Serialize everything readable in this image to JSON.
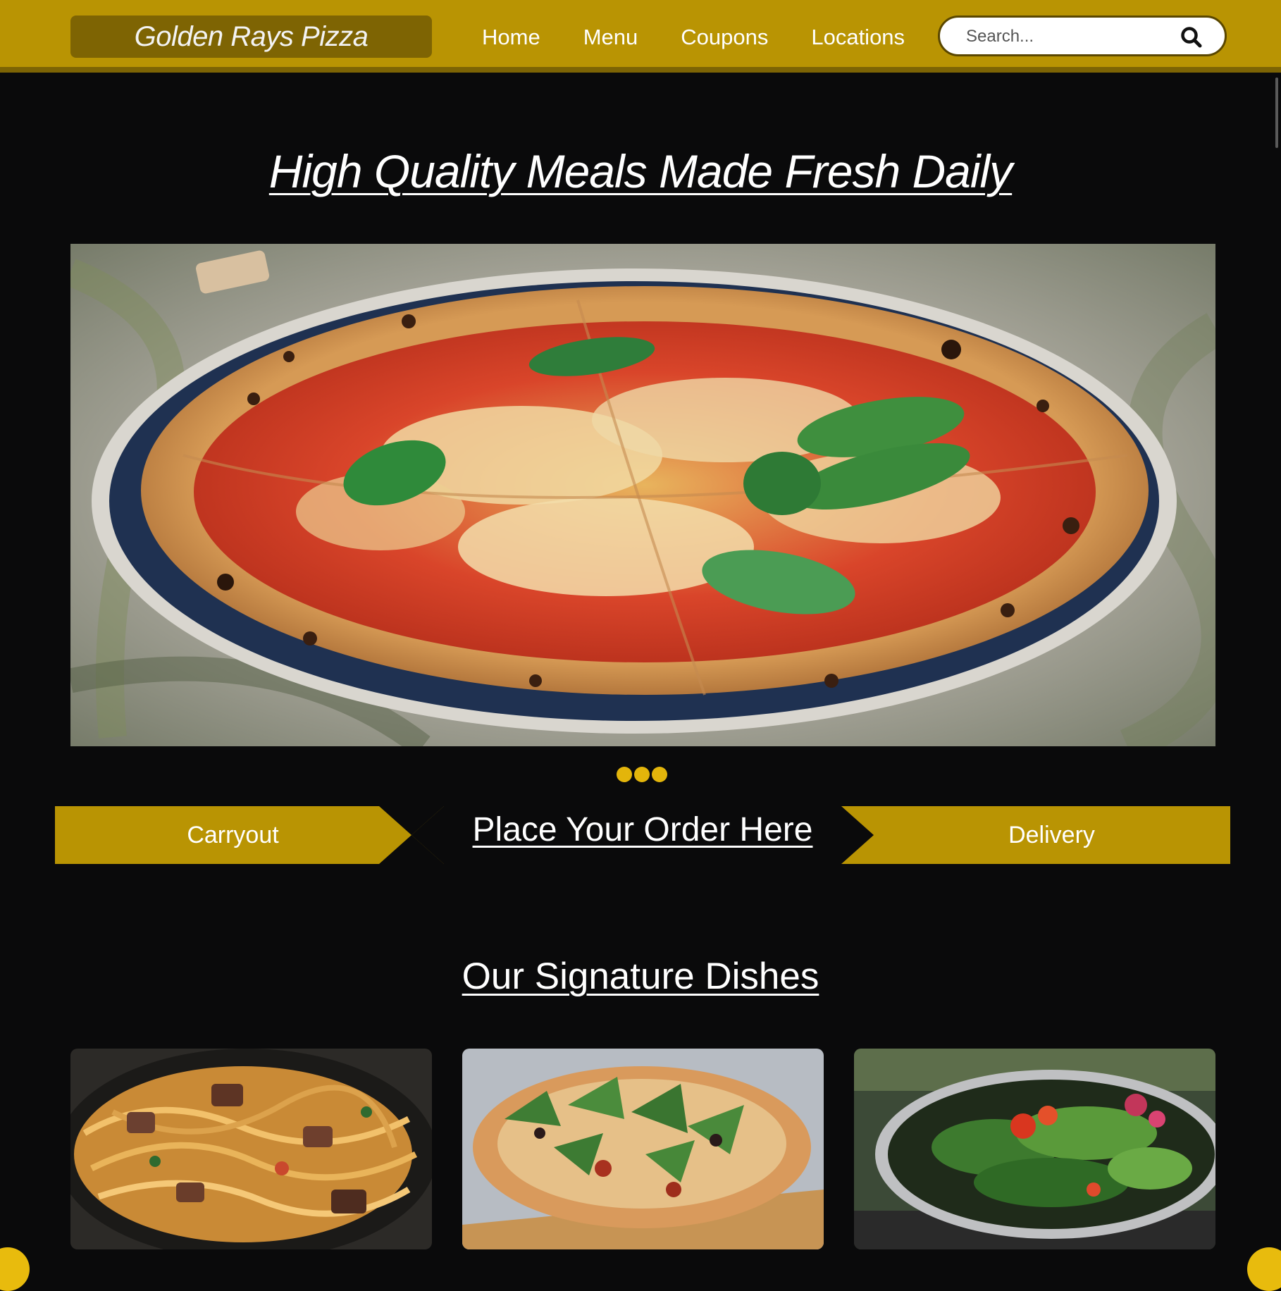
{
  "header": {
    "logo_text": "Golden Rays Pizza",
    "nav": [
      {
        "label": "Home"
      },
      {
        "label": "Menu"
      },
      {
        "label": "Coupons"
      },
      {
        "label": "Locations"
      }
    ],
    "search": {
      "placeholder": "Search...",
      "icon": "search-icon"
    }
  },
  "hero": {
    "title": "High Quality Meals Made Fresh Daily",
    "image": "margherita-pizza-photo",
    "carousel_dots": 3
  },
  "order": {
    "carryout_label": "Carryout",
    "heading": "Place Your Order Here",
    "delivery_label": "Delivery"
  },
  "signature": {
    "heading": "Our Signature Dishes",
    "dishes": [
      {
        "image": "pasta-with-beef-photo"
      },
      {
        "image": "arugula-pizza-photo"
      },
      {
        "image": "green-salad-photo"
      }
    ]
  },
  "colors": {
    "header_bg": "#b99403",
    "logo_bg": "#7e6403",
    "accent": "#e3b50b",
    "page_bg": "#0a0a0b"
  }
}
